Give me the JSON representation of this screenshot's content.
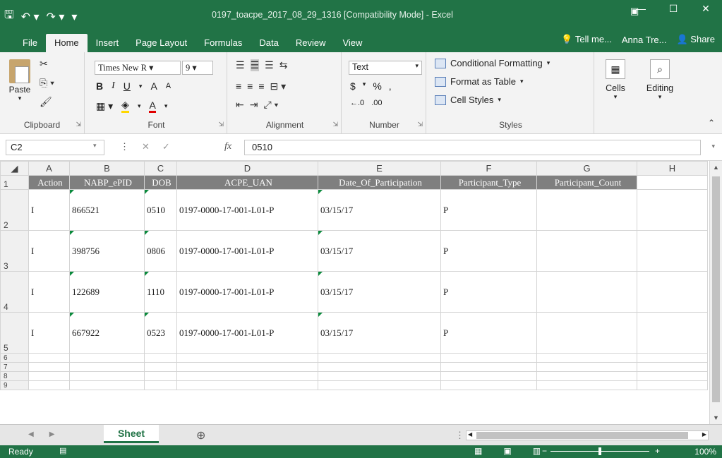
{
  "window": {
    "title": "0197_toacpe_2017_08_29_1316  [Compatibility Mode] - Excel",
    "minimize": "—",
    "maximize": "☐",
    "close": "✕"
  },
  "tabs": [
    "File",
    "Home",
    "Insert",
    "Page Layout",
    "Formulas",
    "Data",
    "Review",
    "View"
  ],
  "active_tab": "Home",
  "tell_me": "Tell me...",
  "user": "Anna Tre...",
  "share": "Share",
  "ribbon": {
    "clipboard": {
      "paste": "Paste",
      "label": "Clipboard"
    },
    "font": {
      "name": "Times New R",
      "size": "9",
      "label": "Font",
      "bold": "B",
      "italic": "I",
      "underline": "U",
      "grow": "A",
      "shrink": "A",
      "color": "A"
    },
    "alignment": {
      "label": "Alignment"
    },
    "number": {
      "format": "Text",
      "currency": "$",
      "percent": "%",
      "comma": ",",
      "inc_dec": "←.0",
      "dec_dec": ".00",
      "label": "Number"
    },
    "styles": {
      "conditional": "Conditional Formatting",
      "table": "Format as Table",
      "cell_styles": "Cell Styles",
      "label": "Styles"
    },
    "cells": {
      "label": "Cells"
    },
    "editing": {
      "label": "Editing"
    }
  },
  "formula_bar": {
    "name_box": "C2",
    "fx": "fx",
    "value": "0510"
  },
  "columns": [
    "A",
    "B",
    "C",
    "D",
    "E",
    "F",
    "G",
    "H"
  ],
  "header_row": [
    "Action",
    "NABP_ePID",
    "DOB",
    "ACPE_UAN",
    "Date_Of_Participation",
    "Participant_Type",
    "Participant_Count",
    ""
  ],
  "rows": [
    {
      "num": "2",
      "cells": [
        "I",
        "866521",
        "0510",
        "0197-0000-17-001-L01-P",
        "03/15/17",
        "P",
        "",
        ""
      ]
    },
    {
      "num": "3",
      "cells": [
        "I",
        "398756",
        "0806",
        "0197-0000-17-001-L01-P",
        "03/15/17",
        "P",
        "",
        ""
      ]
    },
    {
      "num": "4",
      "cells": [
        "I",
        "122689",
        "1110",
        "0197-0000-17-001-L01-P",
        "03/15/17",
        "P",
        "",
        ""
      ]
    },
    {
      "num": "5",
      "cells": [
        "I",
        "667922",
        "0523",
        "0197-0000-17-001-L01-P",
        "03/15/17",
        "P",
        "",
        ""
      ]
    }
  ],
  "empty_rows": [
    "6",
    "7",
    "8",
    "9"
  ],
  "header_row_num": "1",
  "sheet": {
    "name": "Sheet",
    "add": "⊕"
  },
  "status": {
    "ready": "Ready",
    "zoom": "100%"
  }
}
